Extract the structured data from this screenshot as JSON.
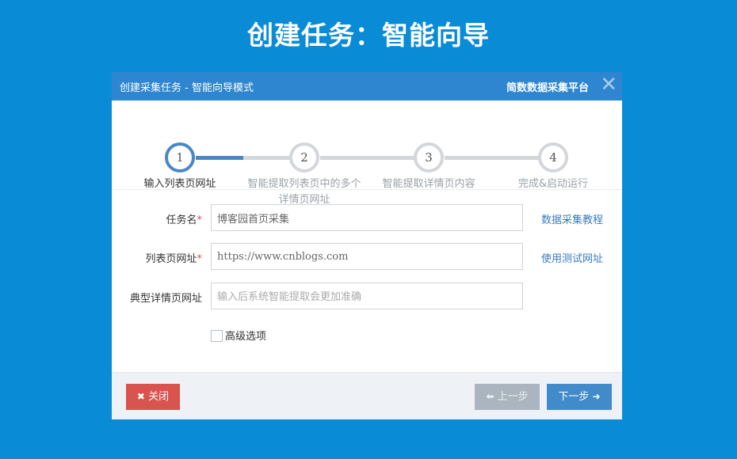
{
  "page": {
    "title": "创建任务：智能向导"
  },
  "dialog": {
    "title": "创建采集任务 - 智能向导模式",
    "brand": "简数数据采集平台",
    "close_glyph": "✕"
  },
  "steps": [
    {
      "number": "1",
      "label": "输入列表页网址"
    },
    {
      "number": "2",
      "label_line1": "智能提取列表页中的多个",
      "label_line2": "详情页网址"
    },
    {
      "number": "3",
      "label": "智能提取详情页内容"
    },
    {
      "number": "4",
      "label": "完成&启动运行"
    }
  ],
  "form": {
    "task_name": {
      "label": "任务名",
      "required": "*",
      "value": "博客园首页采集",
      "link": "数据采集教程"
    },
    "list_url": {
      "label": "列表页网址",
      "required": "*",
      "value": "https://www.cnblogs.com",
      "link": "使用测试网址"
    },
    "detail_url": {
      "label": "典型详情页网址",
      "placeholder": "输入后系统智能提取会更加准确"
    },
    "advanced": {
      "label": "高级选项"
    }
  },
  "footer": {
    "close_label": "关闭",
    "close_icon": "✖",
    "prev_label": "上一步",
    "prev_icon": "⬅",
    "next_label": "下一步",
    "next_icon": "➜"
  },
  "colors": {
    "background": "#0a8bd6",
    "header": "#2e86d0",
    "active_step": "#4a87c3",
    "danger": "#d9534f",
    "primary": "#428bca"
  }
}
